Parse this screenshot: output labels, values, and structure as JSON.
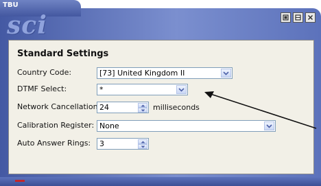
{
  "window": {
    "title": "TBU",
    "logo": "sci"
  },
  "window_buttons": [
    "minimize-icon",
    "maximize-icon",
    "close-icon"
  ],
  "section_title": "Standard Settings",
  "fields": {
    "country_code": {
      "label": "Country Code:",
      "value": "[73] United Kingdom II"
    },
    "dtmf_select": {
      "label": "DTMF Select:",
      "value": "*"
    },
    "network_cancellation": {
      "label": "Network Cancellation:",
      "value": "24",
      "units": "milliseconds"
    },
    "calibration_register": {
      "label": "Calibration Register:",
      "value": "None"
    },
    "auto_answer_rings": {
      "label": "Auto Answer Rings:",
      "value": "3"
    }
  },
  "colors": {
    "frame": "#5c72bb",
    "panel": "#f2f0e7",
    "input_border": "#7f9db9"
  }
}
